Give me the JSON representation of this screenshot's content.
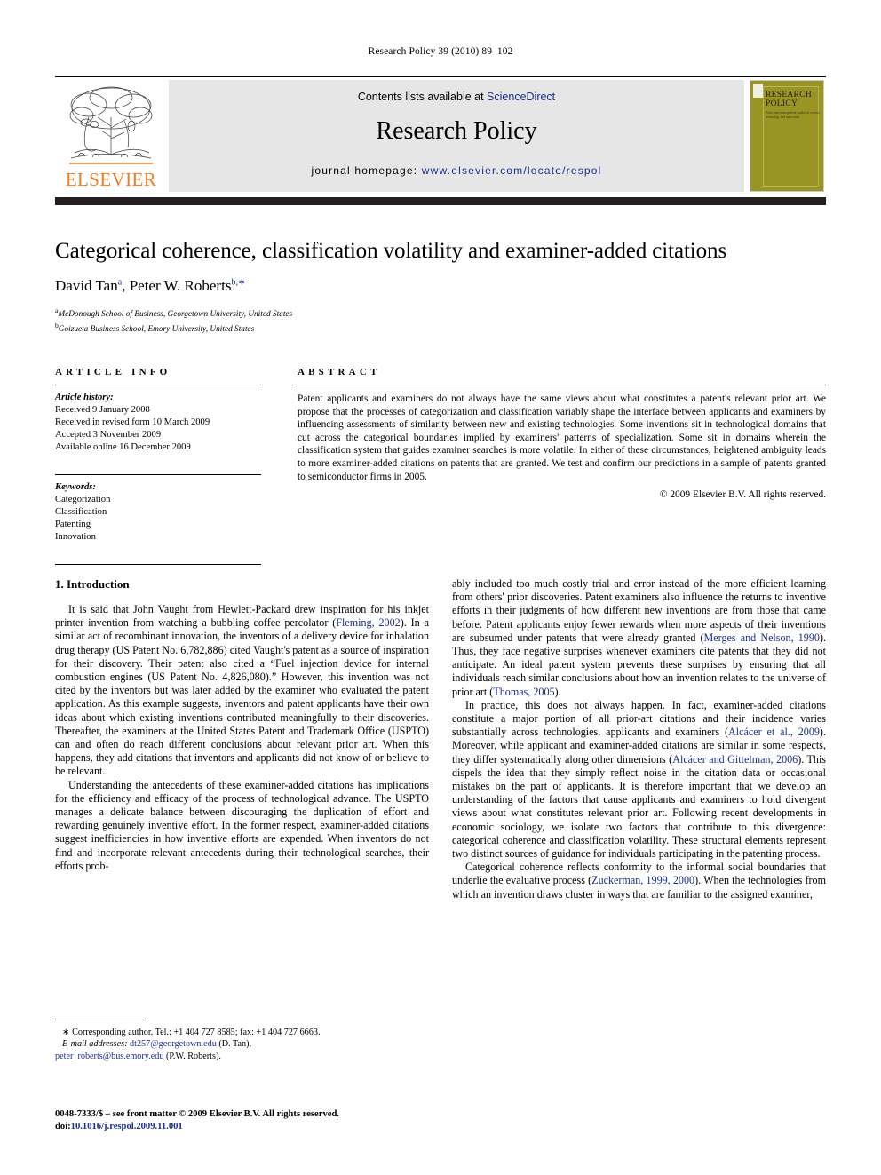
{
  "running_head": "Research Policy 39 (2010) 89–102",
  "masthead": {
    "contents_prefix": "Contents lists available at ",
    "sciencedirect": "ScienceDirect",
    "journal_title": "Research Policy",
    "homepage_prefix": "journal homepage: ",
    "homepage_url": "www.elsevier.com/locate/respol",
    "publisher_wordmark": "ELSEVIER",
    "cover_title": "RESEARCH POLICY",
    "cover_subtitle": "Policy and management studies of science, technology and innovation",
    "accent_orange": "#f47c20",
    "link_blue": "#1a2f8f",
    "cover_olive": "#9a9424",
    "bar_black": "#231f20"
  },
  "title_block": {
    "title": "Categorical coherence, classification volatility and examiner-added citations",
    "authors_1": "David Tan",
    "authors_sup_1": "a",
    "authors_2": ", Peter W. Roberts",
    "authors_sup_2": "b,∗",
    "affiliation_a_sup": "a",
    "affiliation_a": "McDonough School of Business, Georgetown University, United States",
    "affiliation_b_sup": "b",
    "affiliation_b": "Goizueta Business School, Emory University, United States"
  },
  "article_info": {
    "heading": "ARTICLE INFO",
    "history_label": "Article history:",
    "history": [
      "Received 9 January 2008",
      "Received in revised form 10 March 2009",
      "Accepted 3 November 2009",
      "Available online 16 December 2009"
    ],
    "keywords_label": "Keywords:",
    "keywords": [
      "Categorization",
      "Classification",
      "Patenting",
      "Innovation"
    ]
  },
  "abstract": {
    "heading": "ABSTRACT",
    "text": "Patent applicants and examiners do not always have the same views about what constitutes a patent's relevant prior art. We propose that the processes of categorization and classification variably shape the interface between applicants and examiners by influencing assessments of similarity between new and existing technologies. Some inventions sit in technological domains that cut across the categorical boundaries implied by examiners' patterns of specialization. Some sit in domains wherein the classification system that guides examiner searches is more volatile. In either of these circumstances, heightened ambiguity leads to more examiner-added citations on patents that are granted. We test and confirm our predictions in a sample of patents granted to semiconductor firms in 2005.",
    "copyright": "© 2009 Elsevier B.V. All rights reserved."
  },
  "body": {
    "section_heading": "1. Introduction",
    "left_para_1_a": "It is said that John Vaught from Hewlett-Packard drew inspiration for his inkjet printer invention from watching a bubbling coffee percolator (",
    "left_para_1_cite_1": "Fleming, 2002",
    "left_para_1_b": "). In a similar act of recombinant innovation, the inventors of a delivery device for inhalation drug therapy (US Patent No. 6,782,886) cited Vaught's patent as a source of inspiration for their discovery. Their patent also cited a “Fuel injection device for internal combustion engines (US Patent No. 4,826,080).” However, this invention was not cited by the inventors but was later added by the examiner who evaluated the patent application. As this example suggests, inventors and patent applicants have their own ideas about which existing inventions contributed meaningfully to their discoveries. Thereafter, the examiners at the United States Patent and Trademark Office (USPTO) can and often do reach different conclusions about relevant prior art. When this happens, they add citations that inventors and applicants did not know of or believe to be relevant.",
    "left_para_2": "Understanding the antecedents of these examiner-added citations has implications for the efficiency and efficacy of the process of technological advance. The USPTO manages a delicate balance between discouraging the duplication of effort and rewarding genuinely inventive effort. In the former respect, examiner-added citations suggest inefficiencies in how inventive efforts are expended. When inventors do not find and incorporate relevant antecedents during their technological searches, their efforts prob-",
    "right_para_1_a": "ably included too much costly trial and error instead of the more efficient learning from others' prior discoveries. Patent examiners also influence the returns to inventive efforts in their judgments of how different new inventions are from those that came before. Patent applicants enjoy fewer rewards when more aspects of their inventions are subsumed under patents that were already granted (",
    "right_para_1_cite_1": "Merges and Nelson, 1990",
    "right_para_1_b": "). Thus, they face negative surprises whenever examiners cite patents that they did not anticipate. An ideal patent system prevents these surprises by ensuring that all individuals reach similar conclusions about how an invention relates to the universe of prior art (",
    "right_para_1_cite_2": "Thomas, 2005",
    "right_para_1_c": ").",
    "right_para_2_a": "In practice, this does not always happen. In fact, examiner-added citations constitute a major portion of all prior-art citations and their incidence varies substantially across technologies, applicants and examiners (",
    "right_para_2_cite_1": "Alcácer et al., 2009",
    "right_para_2_b": "). Moreover, while applicant and examiner-added citations are similar in some respects, they differ systematically along other dimensions (",
    "right_para_2_cite_2": "Alcácer and Gittelman, 2006",
    "right_para_2_c": "). This dispels the idea that they simply reflect noise in the citation data or occasional mistakes on the part of applicants. It is therefore important that we develop an understanding of the factors that cause applicants and examiners to hold divergent views about what constitutes relevant prior art. Following recent developments in economic sociology, we isolate two factors that contribute to this divergence: categorical coherence and classification volatility. These structural elements represent two distinct sources of guidance for individuals participating in the patenting process.",
    "right_para_3_a": "Categorical coherence reflects conformity to the informal social boundaries that underlie the evaluative process (",
    "right_para_3_cite_1": "Zuckerman, 1999, 2000",
    "right_para_3_b": "). When the technologies from which an invention draws cluster in ways that are familiar to the assigned examiner,"
  },
  "footnote": {
    "marker": "∗",
    "corresponding": "Corresponding author. Tel.: +1 404 727 8585; fax: +1 404 727 6663.",
    "email_label": "E-mail addresses:",
    "email_1": "dt257@georgetown.edu",
    "email_1_owner": " (D. Tan),",
    "email_2": "peter_roberts@bus.emory.edu",
    "email_2_owner": " (P.W. Roberts)."
  },
  "imprint": {
    "line_1": "0048-7333/$ – see front matter © 2009 Elsevier B.V. All rights reserved.",
    "doi_label": "doi:",
    "doi_value": "10.1016/j.respol.2009.11.001"
  }
}
